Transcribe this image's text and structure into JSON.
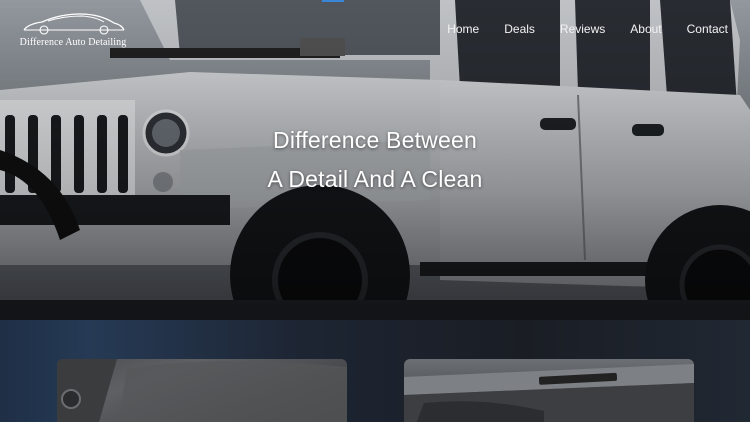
{
  "brand": {
    "name": "Difference Auto Detailing",
    "logo_icon": "car-silhouette-icon"
  },
  "nav": {
    "items": [
      {
        "label": "Home"
      },
      {
        "label": "Deals"
      },
      {
        "label": "Reviews"
      },
      {
        "label": "About"
      },
      {
        "label": "Contact"
      }
    ]
  },
  "hero": {
    "title_line1": "Difference Between",
    "title_line2": "A Detail And A Clean",
    "image": "white-jeep-wrangler-photo"
  },
  "cards": [
    {
      "image": "car-carpet-interior-photo"
    },
    {
      "image": "car-door-panel-interior-photo"
    }
  ],
  "colors": {
    "accent": "#3a86d6",
    "text": "#ffffff"
  }
}
